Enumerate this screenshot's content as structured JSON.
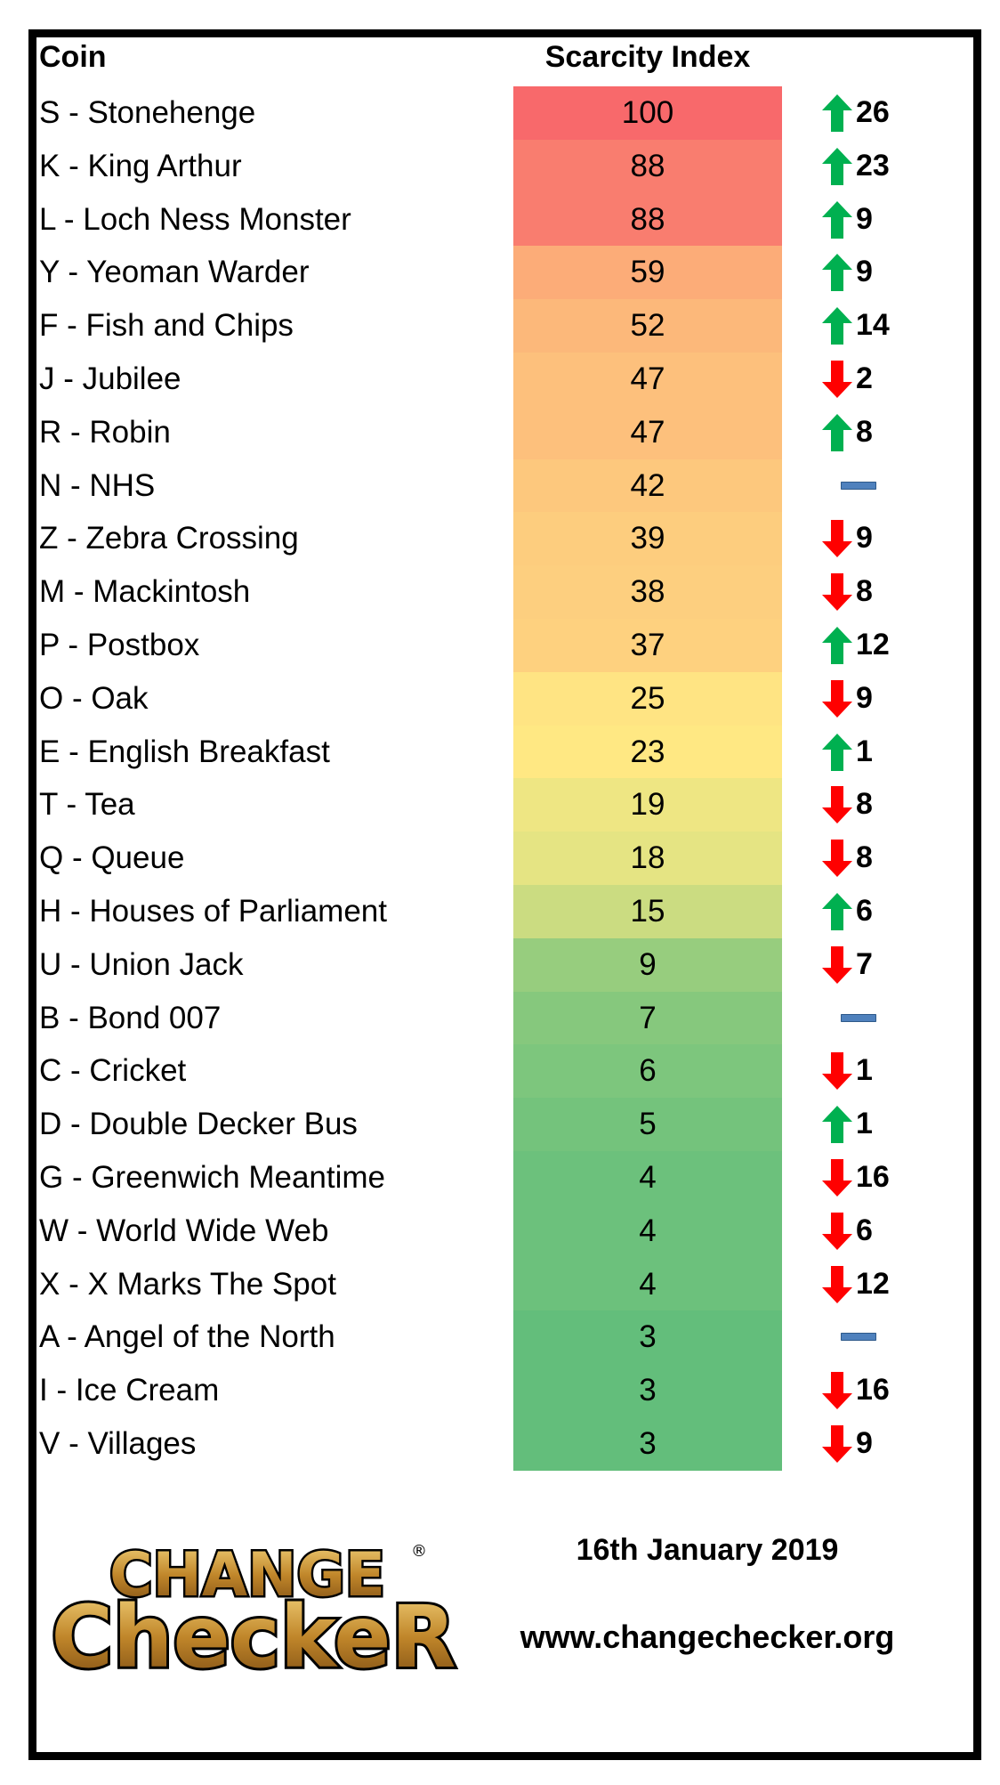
{
  "header": {
    "coin": "Coin",
    "scarcity": "Scarcity Index"
  },
  "scale_colors": {
    "low": "#63BE7B",
    "mid": "#FFEB84",
    "high": "#F8696B"
  },
  "change_colors": {
    "up": "#00B050",
    "down": "#FF0000",
    "none": "#4F81BD"
  },
  "rows": [
    {
      "coin": "S - Stonehenge",
      "index": 100,
      "direction": "up",
      "change": "26"
    },
    {
      "coin": "K - King Arthur",
      "index": 88,
      "direction": "up",
      "change": "23"
    },
    {
      "coin": "L - Loch Ness Monster",
      "index": 88,
      "direction": "up",
      "change": "9"
    },
    {
      "coin": "Y - Yeoman Warder",
      "index": 59,
      "direction": "up",
      "change": "9"
    },
    {
      "coin": "F - Fish and Chips",
      "index": 52,
      "direction": "up",
      "change": "14"
    },
    {
      "coin": "J - Jubilee",
      "index": 47,
      "direction": "down",
      "change": "2"
    },
    {
      "coin": "R - Robin",
      "index": 47,
      "direction": "up",
      "change": "8"
    },
    {
      "coin": "N - NHS",
      "index": 42,
      "direction": "none",
      "change": ""
    },
    {
      "coin": "Z - Zebra Crossing",
      "index": 39,
      "direction": "down",
      "change": "9"
    },
    {
      "coin": "M - Mackintosh",
      "index": 38,
      "direction": "down",
      "change": "8"
    },
    {
      "coin": "P - Postbox",
      "index": 37,
      "direction": "up",
      "change": "12"
    },
    {
      "coin": "O - Oak",
      "index": 25,
      "direction": "down",
      "change": "9"
    },
    {
      "coin": "E - English Breakfast",
      "index": 23,
      "direction": "up",
      "change": "1"
    },
    {
      "coin": "T - Tea",
      "index": 19,
      "direction": "down",
      "change": "8"
    },
    {
      "coin": "Q - Queue",
      "index": 18,
      "direction": "down",
      "change": "8"
    },
    {
      "coin": "H - Houses of Parliament",
      "index": 15,
      "direction": "up",
      "change": "6"
    },
    {
      "coin": "U - Union Jack",
      "index": 9,
      "direction": "down",
      "change": "7"
    },
    {
      "coin": "B - Bond 007",
      "index": 7,
      "direction": "none",
      "change": ""
    },
    {
      "coin": "C - Cricket",
      "index": 6,
      "direction": "down",
      "change": "1"
    },
    {
      "coin": "D - Double Decker Bus",
      "index": 5,
      "direction": "up",
      "change": "1"
    },
    {
      "coin": "G - Greenwich Meantime",
      "index": 4,
      "direction": "down",
      "change": "16"
    },
    {
      "coin": "W - World Wide Web",
      "index": 4,
      "direction": "down",
      "change": "6"
    },
    {
      "coin": "X - X Marks The Spot",
      "index": 4,
      "direction": "down",
      "change": "12"
    },
    {
      "coin": "A - Angel of the North",
      "index": 3,
      "direction": "none",
      "change": ""
    },
    {
      "coin": "I - Ice Cream",
      "index": 3,
      "direction": "down",
      "change": "16"
    },
    {
      "coin": "V - Villages",
      "index": 3,
      "direction": "down",
      "change": "9"
    }
  ],
  "footer": {
    "logo_line1": "CHANGE",
    "logo_line2": "CheckeR",
    "logo_mark": "®",
    "date": "16th January 2019",
    "url": "www.changechecker.org"
  }
}
